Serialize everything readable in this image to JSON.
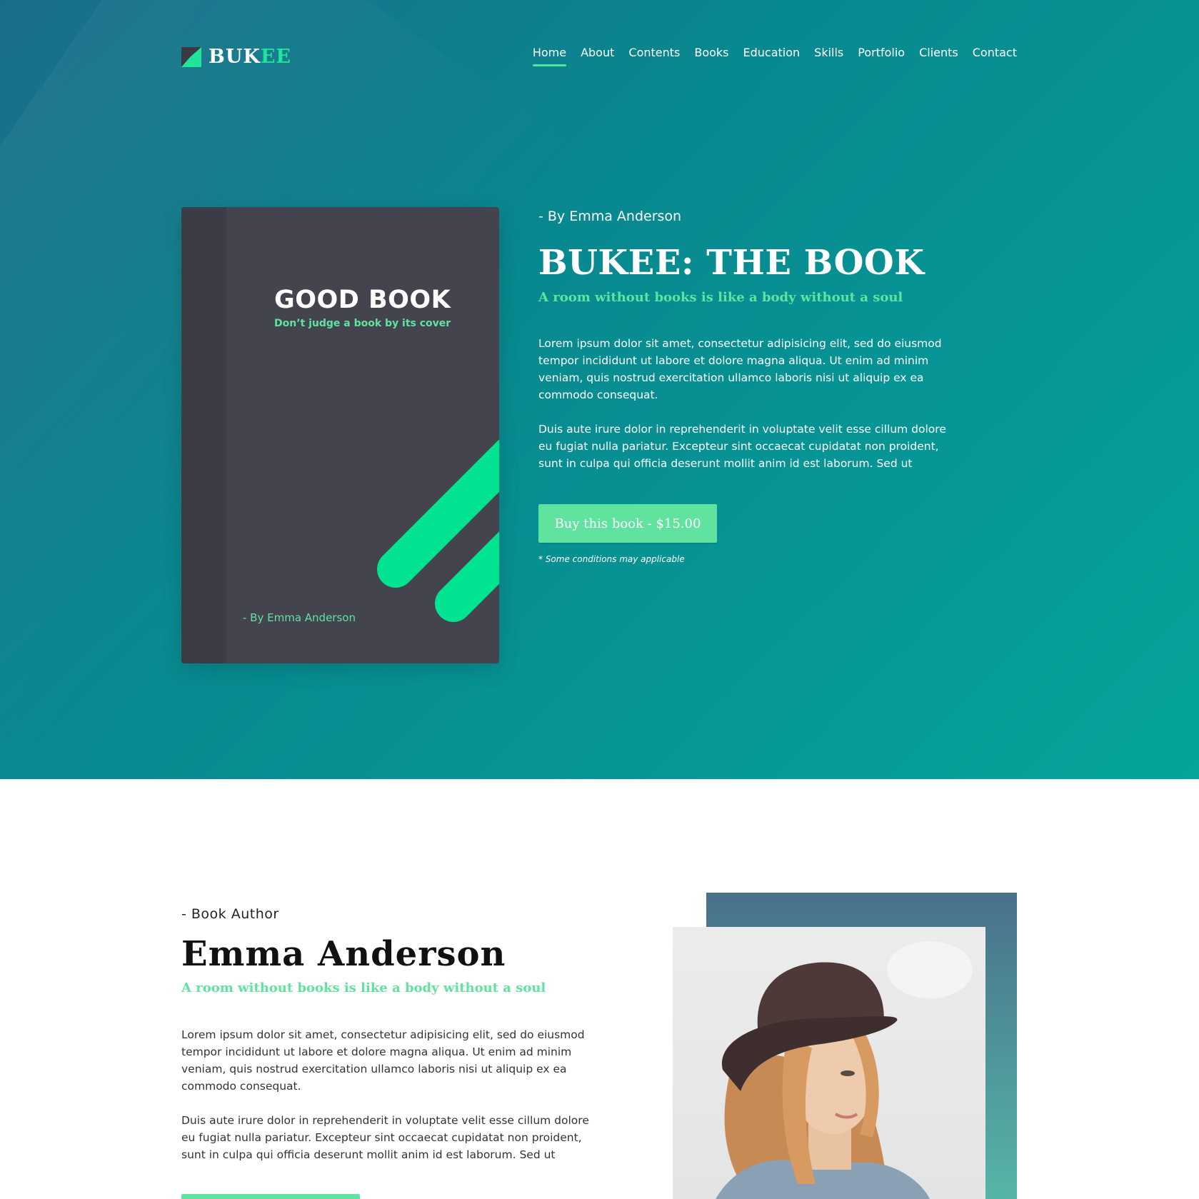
{
  "brand": {
    "name_main": "BUK",
    "name_accent": "EE"
  },
  "nav": {
    "items": [
      {
        "label": "Home",
        "active": true
      },
      {
        "label": "About",
        "active": false
      },
      {
        "label": "Contents",
        "active": false
      },
      {
        "label": "Books",
        "active": false
      },
      {
        "label": "Education",
        "active": false
      },
      {
        "label": "Skills",
        "active": false
      },
      {
        "label": "Portfolio",
        "active": false
      },
      {
        "label": "Clients",
        "active": false
      },
      {
        "label": "Contact",
        "active": false
      }
    ]
  },
  "book_cover": {
    "title": "GOOD BOOK",
    "subtitle": "Don’t judge a book by its cover",
    "author": "- By Emma Anderson"
  },
  "hero": {
    "by": "- By Emma Anderson",
    "title": "BUKEE: THE BOOK",
    "tagline": "A room without books is like a body without a soul",
    "paragraph1": "Lorem ipsum dolor sit amet, consectetur adipisicing elit, sed do eiusmod tempor incididunt ut labore et dolore magna aliqua. Ut enim ad minim veniam, quis nostrud exercitation ullamco laboris nisi ut aliquip ex ea commodo consequat.",
    "paragraph2": "Duis aute irure dolor in reprehenderit in voluptate velit esse cillum dolore eu fugiat nulla pariatur. Excepteur sint occaecat cupidatat non proident, sunt in culpa qui officia deserunt mollit anim id est laborum. Sed ut",
    "buy_label": "Buy this book - $15.00",
    "note": "* Some conditions may applicable"
  },
  "author": {
    "label": "- Book Author",
    "name": "Emma Anderson",
    "tagline": "A room without books is like a body without a soul",
    "paragraph1": "Lorem ipsum dolor sit amet, consectetur adipisicing elit, sed do eiusmod tempor incididunt ut labore et dolore magna aliqua. Ut enim ad minim veniam, quis nostrud exercitation ullamco laboris nisi ut aliquip ex ea commodo consequat.",
    "paragraph2": "Duis aute irure dolor in reprehenderit in voluptate velit esse cillum dolore eu fugiat nulla pariatur. Excepteur sint occaecat cupidatat non proident, sunt in culpa qui officia deserunt mollit anim id est laborum. Sed ut"
  },
  "colors": {
    "accent": "#5fe39e",
    "logo_accent": "#1ee59a",
    "hero_start": "#1a6d88",
    "hero_end": "#05a59b",
    "book_cover": "#44444f"
  },
  "icons": {
    "logo": "logo-mark-icon"
  }
}
